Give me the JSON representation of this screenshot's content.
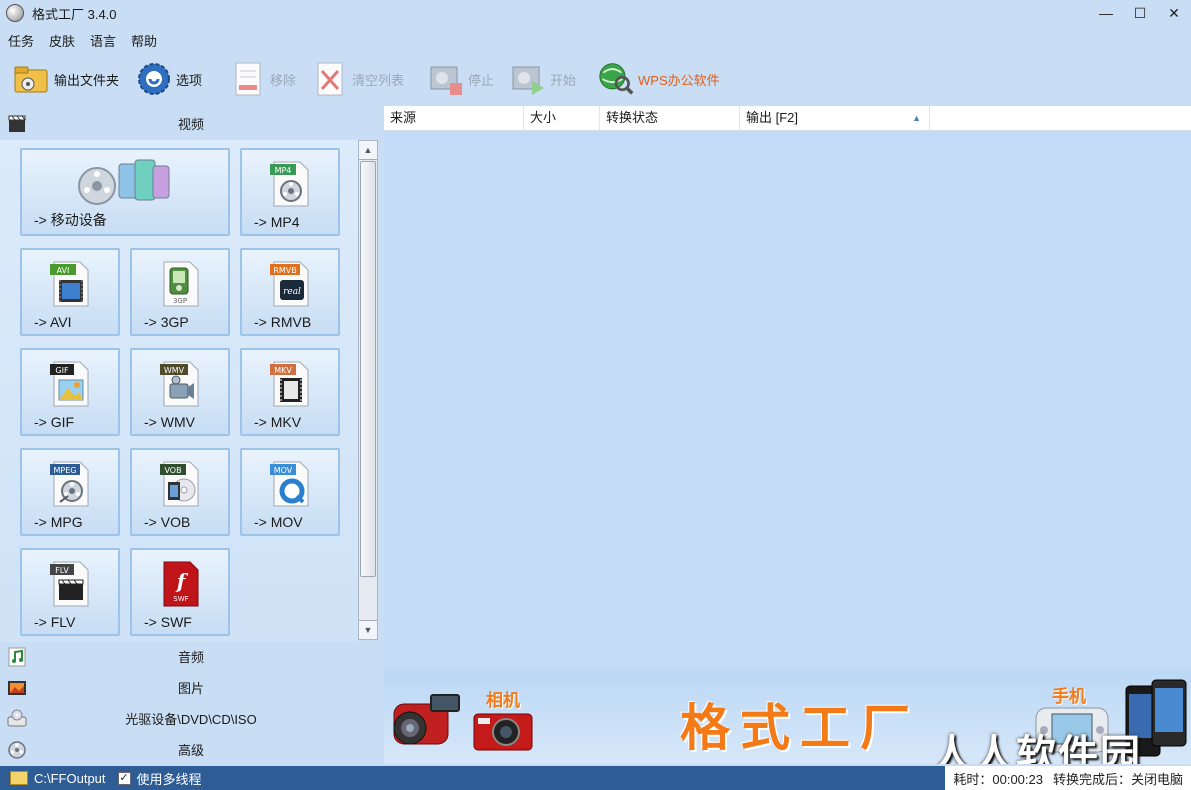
{
  "window": {
    "title": "格式工厂 3.4.0",
    "minimize": "—",
    "maximize": "☐",
    "close": "✕"
  },
  "menu": [
    "任务",
    "皮肤",
    "语言",
    "帮助"
  ],
  "toolbar": {
    "output_folder": "输出文件夹",
    "options": "选项",
    "remove": "移除",
    "clear_list": "清空列表",
    "stop": "停止",
    "start": "开始",
    "wps": "WPS办公软件"
  },
  "categories": {
    "video": "视频",
    "audio": "音频",
    "image": "图片",
    "disc": "光驱设备\\DVD\\CD\\ISO",
    "advanced": "高级"
  },
  "tiles": [
    {
      "label": "-> 移动设备",
      "icon": "mobile-device-icon",
      "badge": ""
    },
    {
      "label": "-> MP4",
      "icon": "mp4-icon",
      "badge": "MP4",
      "color": "#3a9a55"
    },
    {
      "label": "-> AVI",
      "icon": "avi-icon",
      "badge": "AVI",
      "color": "#4a9a2e"
    },
    {
      "label": "-> 3GP",
      "icon": "3gp-icon",
      "badge": "",
      "color": "#4f8f3f"
    },
    {
      "label": "-> RMVB",
      "icon": "rmvb-icon",
      "badge": "RMVB",
      "color": "#e07020"
    },
    {
      "label": "-> GIF",
      "icon": "gif-icon",
      "badge": "GIF",
      "color": "#222222"
    },
    {
      "label": "-> WMV",
      "icon": "wmv-icon",
      "badge": "WMV",
      "color": "#4e4a2a"
    },
    {
      "label": "-> MKV",
      "icon": "mkv-icon",
      "badge": "MKV",
      "color": "#d07040"
    },
    {
      "label": "-> MPG",
      "icon": "mpg-icon",
      "badge": "MPEG",
      "color": "#2e5d96"
    },
    {
      "label": "-> VOB",
      "icon": "vob-icon",
      "badge": "VOB",
      "color": "#2e4e2e"
    },
    {
      "label": "-> MOV",
      "icon": "mov-icon",
      "badge": "MOV",
      "color": "#3a8ed8"
    },
    {
      "label": "-> FLV",
      "icon": "flv-icon",
      "badge": "FLV",
      "color": "#444444"
    },
    {
      "label": "-> SWF",
      "icon": "swf-icon",
      "badge": "SWF",
      "color": "#c0141b"
    }
  ],
  "table": {
    "col_source": "来源",
    "col_size": "大小",
    "col_status": "转换状态",
    "col_output": "输出 [F2]"
  },
  "banner": {
    "camera_label": "相机",
    "title": "格式工厂",
    "phone_label": "手机",
    "watermark": "人人软件园"
  },
  "status": {
    "output_path": "C:\\FFOutput",
    "multithread_label": "使用多线程",
    "multithread_checked": true,
    "elapsed": "耗时：00:00:23",
    "after_done": "转换完成后：关闭电脑"
  }
}
